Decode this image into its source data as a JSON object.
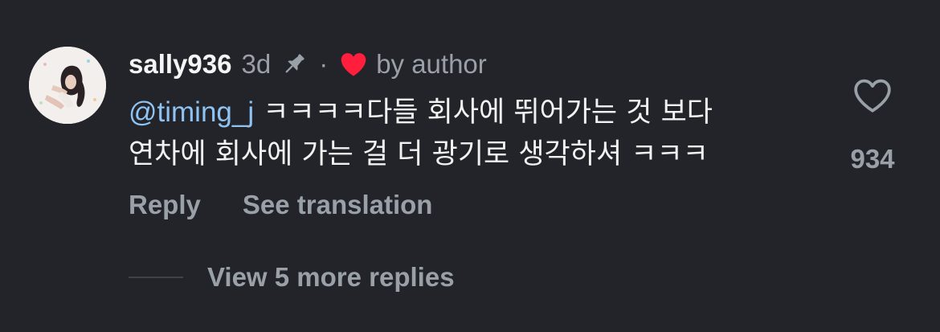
{
  "comment": {
    "username": "sally936",
    "time": "3d",
    "separator": "·",
    "author_badge": "by author",
    "mention": "@timing_j",
    "text_line1": " ㅋㅋㅋㅋ다들 회사에 뛰어가는 것 보다",
    "text_line2": "연차에 회사에 가는 걸 더 광기로 생각하셔 ㅋㅋㅋ",
    "like_count": "934"
  },
  "actions": {
    "reply_label": "Reply",
    "translate_label": "See translation"
  },
  "replies": {
    "view_more_label": "View 5 more replies"
  },
  "icons": {
    "pin": "pin-icon",
    "author_heart": "heart-filled-icon",
    "like": "heart-outline-icon"
  },
  "colors": {
    "background": "#22242a",
    "mention": "#8fc3f2",
    "heart_red": "#ff1e3c",
    "muted": "#9aa0a8"
  }
}
